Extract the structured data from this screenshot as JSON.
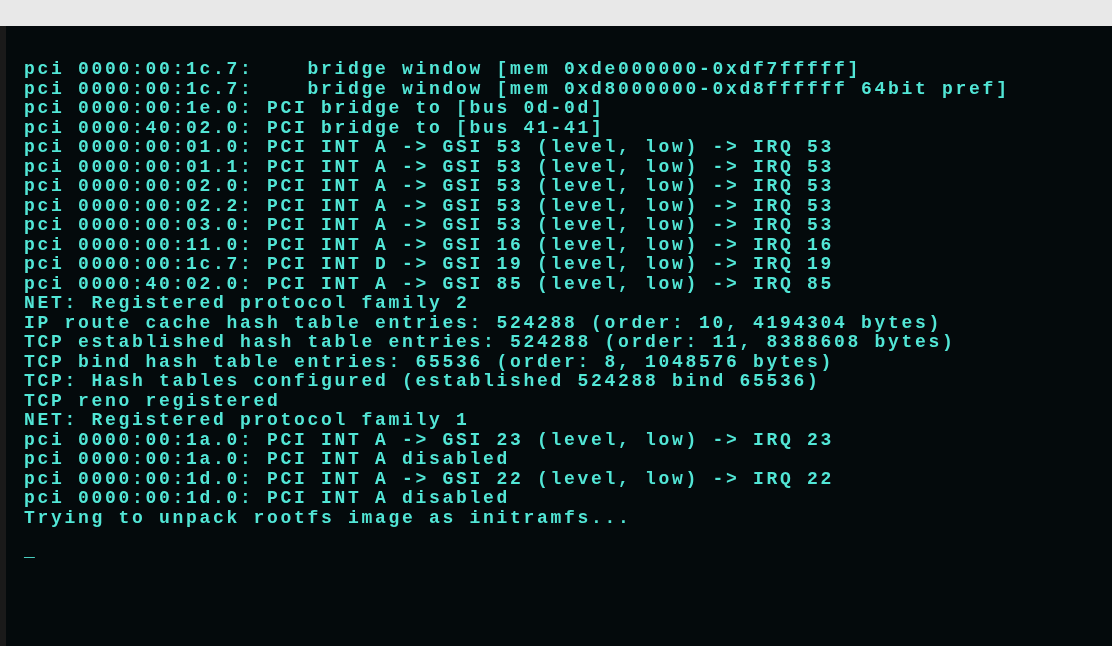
{
  "console": {
    "lines": [
      "pci 0000:00:1c.7:    bridge window [mem 0xde000000-0xdf7fffff]",
      "pci 0000:00:1c.7:    bridge window [mem 0xd8000000-0xd8ffffff 64bit pref]",
      "pci 0000:00:1e.0: PCI bridge to [bus 0d-0d]",
      "pci 0000:40:02.0: PCI bridge to [bus 41-41]",
      "pci 0000:00:01.0: PCI INT A -> GSI 53 (level, low) -> IRQ 53",
      "pci 0000:00:01.1: PCI INT A -> GSI 53 (level, low) -> IRQ 53",
      "pci 0000:00:02.0: PCI INT A -> GSI 53 (level, low) -> IRQ 53",
      "pci 0000:00:02.2: PCI INT A -> GSI 53 (level, low) -> IRQ 53",
      "pci 0000:00:03.0: PCI INT A -> GSI 53 (level, low) -> IRQ 53",
      "pci 0000:00:11.0: PCI INT A -> GSI 16 (level, low) -> IRQ 16",
      "pci 0000:00:1c.7: PCI INT D -> GSI 19 (level, low) -> IRQ 19",
      "pci 0000:40:02.0: PCI INT A -> GSI 85 (level, low) -> IRQ 85",
      "NET: Registered protocol family 2",
      "IP route cache hash table entries: 524288 (order: 10, 4194304 bytes)",
      "TCP established hash table entries: 524288 (order: 11, 8388608 bytes)",
      "TCP bind hash table entries: 65536 (order: 8, 1048576 bytes)",
      "TCP: Hash tables configured (established 524288 bind 65536)",
      "TCP reno registered",
      "NET: Registered protocol family 1",
      "pci 0000:00:1a.0: PCI INT A -> GSI 23 (level, low) -> IRQ 23",
      "pci 0000:00:1a.0: PCI INT A disabled",
      "pci 0000:00:1d.0: PCI INT A -> GSI 22 (level, low) -> IRQ 22",
      "pci 0000:00:1d.0: PCI INT A disabled",
      "Trying to unpack rootfs image as initramfs..."
    ],
    "cursor": "_"
  }
}
